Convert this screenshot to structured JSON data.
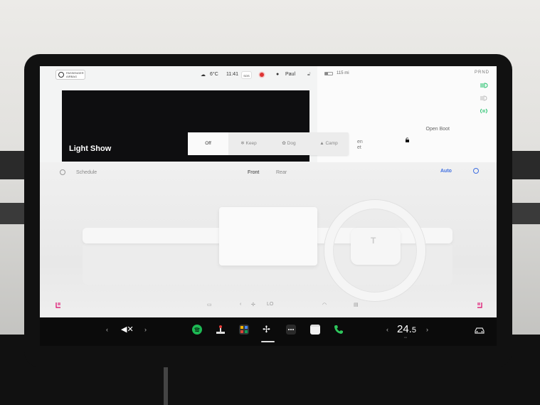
{
  "topbar": {
    "airbag_label": "PASSENGER AIRBAG",
    "weather_temp": "6°C",
    "time": "11:41",
    "sos": "SOS",
    "user": "Paul"
  },
  "rightpanel": {
    "range": "115 mi",
    "gear": "PRND",
    "open_boot": "Open Boot",
    "partial_label": "en et"
  },
  "lightshow": {
    "title": "Light Show"
  },
  "modes": [
    {
      "label": "Off",
      "selected": true
    },
    {
      "label": "Keep"
    },
    {
      "label": "Dog"
    },
    {
      "label": "Camp"
    }
  ],
  "climate": {
    "schedule": "Schedule",
    "front": "Front",
    "rear": "Rear",
    "auto": "Auto",
    "fan_level": "LO"
  },
  "taskbar": {
    "volume": "✕",
    "temperature_whole": "24.",
    "temperature_decimal": "5"
  },
  "colors": {
    "accent": "#3e6ee0",
    "spotify": "#1DB954",
    "phone": "#2ec65c",
    "record": "#dd3333",
    "headlight_green": "#21c06b"
  },
  "icons": [
    "weather-icon",
    "person-icon",
    "lock-icon",
    "battery-icon",
    "headlight-icon",
    "fan-icon",
    "spotify-icon",
    "joystick-icon",
    "apps-icon",
    "dots-icon",
    "calendar-icon",
    "phone-icon",
    "car-icon",
    "power-icon",
    "clock-icon",
    "seat-heater-icon"
  ]
}
